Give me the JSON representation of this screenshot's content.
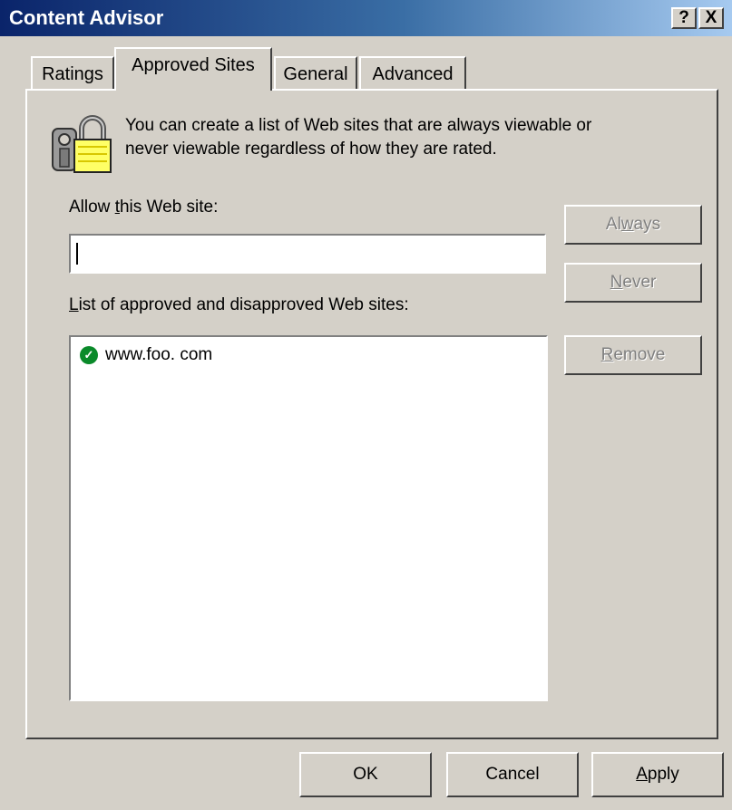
{
  "window": {
    "title": "Content Advisor",
    "help_label": "?",
    "close_label": "X"
  },
  "tabs": [
    {
      "label": "Ratings",
      "active": false
    },
    {
      "label": "Approved Sites",
      "active": true
    },
    {
      "label": "General",
      "active": false
    },
    {
      "label": "Advanced",
      "active": false
    }
  ],
  "info": {
    "icon": "lock-with-keys-icon",
    "line1": "You can create a list of Web sites that are always viewable or",
    "line2": "never viewable regardless of how they are rated."
  },
  "allow": {
    "label_pre": "Allow ",
    "label_ul": "t",
    "label_post": "his Web site:",
    "value": ""
  },
  "list": {
    "label_ul": "L",
    "label_post": "ist of approved and disapproved Web sites:",
    "items": [
      {
        "icon": "approved-check-icon",
        "text": "www.foo. com"
      }
    ]
  },
  "side_buttons": {
    "always": {
      "pre": "Al",
      "ul": "w",
      "post": "ays"
    },
    "never": {
      "pre": "",
      "ul": "N",
      "post": "ever"
    },
    "remove": {
      "pre": "",
      "ul": "R",
      "post": "emove"
    }
  },
  "footer": {
    "ok": "OK",
    "cancel": "Cancel",
    "apply_ul": "A",
    "apply_post": "pply"
  },
  "colors": {
    "title_start": "#0a246a",
    "title_end": "#a6caf0",
    "face": "#d4d0c8",
    "check_green": "#0a8a2a"
  }
}
